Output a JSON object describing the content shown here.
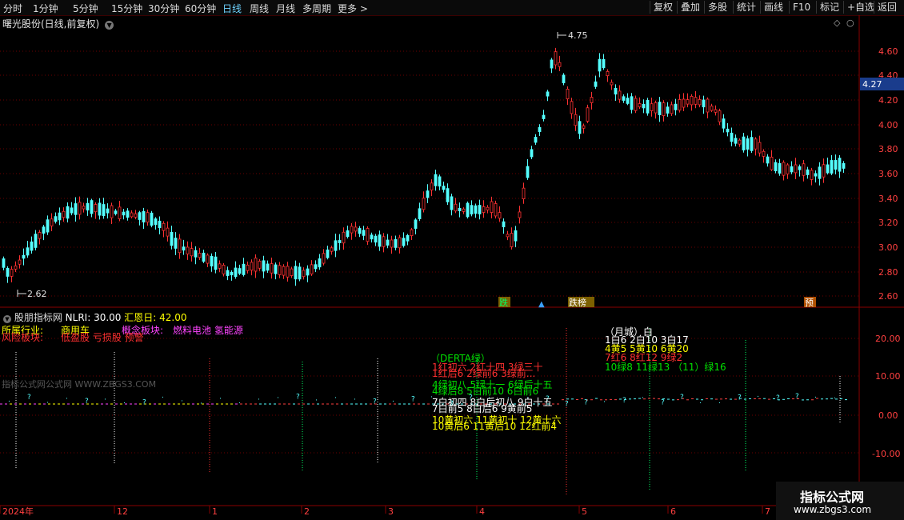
{
  "toolbar": {
    "timeframes": [
      "分时",
      "1分钟",
      "5分钟",
      "15分钟",
      "30分钟",
      "60分钟",
      "日线",
      "周线",
      "月线",
      "多周期",
      "更多 >"
    ],
    "active_timeframe": "日线",
    "buttons": [
      "复权",
      "叠加",
      "多股",
      "统计",
      "画线",
      "F10",
      "标记",
      "+自选",
      "返回"
    ]
  },
  "stock": {
    "title": "曙光股份(日线,前复权)",
    "high_label": "4.75",
    "low_label": "2.62",
    "price_tag": "4.27",
    "event_markers": [
      "跌",
      "跌榜",
      "预"
    ]
  },
  "price_axis": {
    "ticks": [
      "4.60",
      "4.40",
      "4.20",
      "4.00",
      "3.80",
      "3.60",
      "3.40",
      "3.20",
      "3.00",
      "2.80",
      "2.60"
    ]
  },
  "indicator": {
    "name": "股朋指标网",
    "nlri_label": "NLRI: 30.00",
    "huien_label": "汇恩日: 42.00",
    "row1": {
      "industry_label": "所属行业:",
      "industry_value": "商用车",
      "concept_label": "概念板块:",
      "concept_value": "燃料电池 氢能源"
    },
    "row2": {
      "risk_label": "风险板块:",
      "risk_value": "低盈股 亏损股 预警"
    },
    "watermark_text": "指标公式网公式网 WWW.ZBGS3.COM",
    "axis_ticks": [
      "20.00",
      "10.00",
      "0.00",
      "-10.00"
    ],
    "derta": {
      "title": "（DERTA绿）",
      "red_lines": [
        "1红初六  2红十四  3绿三十",
        "1红后6  2绿前6  3绿前..."
      ],
      "green_lines": [
        "4绿初八  5绿十一  6绿后十五",
        "4绿后8  5白前10  6白前6"
      ],
      "white_lines": [
        "7白初四  8白后初八  9白十五",
        "7白前5  8白后6  9黄前5"
      ],
      "yellow_lines": [
        "10黄初六  11黄初十  12黄十六",
        "10黄后6  11黄后10  12红前4"
      ]
    },
    "yuecheng": {
      "title": "（月城）白",
      "white_line": "1白6  2白10  3白17",
      "yellow_line": "4黄5  5黄10  6黄20",
      "red_line": "7红6  8红12  9绿2",
      "green_line": "10绿8  11绿13  （11）绿16"
    }
  },
  "time_axis": {
    "labels": [
      "2024年",
      "12",
      "1",
      "2",
      "3",
      "4",
      "5",
      "6",
      "7"
    ]
  },
  "watermark": {
    "line1": "指标公式网",
    "line2": "www.zbgs3.com"
  },
  "colors": {
    "up": "#ff3232",
    "down": "#54ffff",
    "grid": "#6a0000",
    "white": "#ffffff",
    "yellow": "#ffff00",
    "green": "#00e000",
    "magenta": "#ff44ff"
  }
}
